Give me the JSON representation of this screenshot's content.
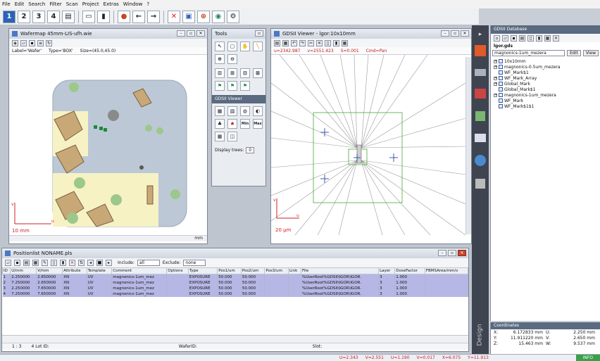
{
  "menu": [
    "File",
    "Edit",
    "Search",
    "Filter",
    "Scan",
    "Project",
    "Extras",
    "Window",
    "?"
  ],
  "toolbar": {
    "numbers": [
      "1",
      "2",
      "3",
      "4"
    ]
  },
  "wafermap": {
    "title": "Wafermap 45mm-LIS-ufh.wie",
    "label_text": "Label='Wafer'",
    "type_text": "Type='BOX'",
    "size_text": "Size=(45.0,45.0)",
    "scale_label": "10 mm",
    "unit": "mm",
    "axis_u": "u",
    "axis_v": "v"
  },
  "tools": {
    "title": "Tools",
    "subpanel_title": "GDSII Viewer",
    "display_trees_label": "Display trees:",
    "display_trees_value": "0",
    "min_label": "Min",
    "max_label": "Max"
  },
  "gdsviewer": {
    "title": "GDSII Viewer - lgor:10x10mm",
    "u_text": "u=2342.987",
    "v_text": "v=2551.423",
    "s_text": "S=0.001",
    "cmd_text": "Cmd=Pan",
    "scale_label": "20 µm",
    "axis_u": "u",
    "axis_v": "v"
  },
  "positionlist": {
    "title": "Positionlist NONAME.pls",
    "include_label": "Include:",
    "include_value": "all",
    "exclude_label": "Exclude:",
    "exclude_value": "none",
    "columns": [
      "ID",
      "U/mm",
      "V/mm",
      "Attribute",
      "Template",
      "Comment",
      "Options",
      "Type",
      "Pos1/um",
      "Pos2/um",
      "Pos3/um",
      "Link",
      "File",
      "Layer",
      "DoseFactor",
      "FBMSArea/mm/s"
    ],
    "rows": [
      [
        "1",
        "2.250000",
        "2.650000",
        "XN",
        "UV",
        "magnonics-1um_mez",
        "",
        "EXPOSURE",
        "50.000",
        "50.000",
        "",
        "",
        "%UserRoot%GDSII\\IGOR\\IGOR.",
        "3",
        "1.000",
        ""
      ],
      [
        "2",
        "7.250000",
        "2.650000",
        "XN",
        "UV",
        "magnonics-1um_mez",
        "",
        "EXPOSURE",
        "50.000",
        "50.000",
        "",
        "",
        "%UserRoot%GDSII\\IGOR\\IGOR.",
        "3",
        "1.000",
        ""
      ],
      [
        "3",
        "2.250000",
        "7.650000",
        "XN",
        "UV",
        "magnonics-1um_mez",
        "",
        "EXPOSURE",
        "50.000",
        "50.000",
        "",
        "",
        "%UserRoot%GDSII\\IGOR\\IGOR.",
        "3",
        "1.000",
        ""
      ],
      [
        "4",
        "7.250000",
        "7.650000",
        "XN",
        "UV",
        "magnonics-1um_mez",
        "",
        "EXPOSURE",
        "50.000",
        "50.000",
        "",
        "",
        "%UserRoot%GDSII\\IGOR\\IGOR.",
        "3",
        "1.000",
        ""
      ]
    ],
    "status_pos": "1 : 3",
    "status_lot": "4  Lot ID:",
    "status_wafer": "WaferID:",
    "status_slot": "Slot:"
  },
  "gdsdb": {
    "title": "GDSII Database",
    "file": "lgor.gds",
    "selected": "magnonics-1um_mezera",
    "edit_label": "Edit",
    "view_label": "View",
    "tree": [
      {
        "label": "10x10mm",
        "expander": "+",
        "indent": 0
      },
      {
        "label": "magnonics-0.5um_mezera",
        "expander": "+",
        "indent": 0
      },
      {
        "label": "WF_Mark$1",
        "expander": "",
        "indent": 0
      },
      {
        "label": "WF_Mark_Array",
        "expander": "+",
        "indent": 0
      },
      {
        "label": "Global_Mark",
        "expander": "+",
        "indent": 0
      },
      {
        "label": "Global_Mark$1",
        "expander": "",
        "indent": 0
      },
      {
        "label": "magnonics-1um_mezera",
        "expander": "+",
        "indent": 0
      },
      {
        "label": "WF_Mark",
        "expander": "",
        "indent": 0
      },
      {
        "label": "WF_Mark$1$1",
        "expander": "",
        "indent": 0
      }
    ],
    "design_label": "Design"
  },
  "coords": {
    "title": "Coordinates",
    "x_label": "X:",
    "x_value": "6.172833 mm",
    "y_label": "Y:",
    "y_value": "11.911220 mm",
    "z_label": "Z:",
    "z_value": "15.463 mm",
    "u_label": "U:",
    "u_value": "2.250 mm",
    "v_label": "V:",
    "v_value": "2.650 mm",
    "w_label": "W:",
    "w_value": "9.537 mm"
  },
  "statusbar": {
    "u": "U=2.343",
    "v": "V=2.551",
    "du": "U=1.190",
    "dv": "V=0.017",
    "lx": "X=6.075",
    "ly": "Y=11.913",
    "info": "INFO"
  },
  "colors": {
    "accent": "#2a63b8",
    "row_selected": "#b7b7e6",
    "highlight": "#d22020"
  }
}
